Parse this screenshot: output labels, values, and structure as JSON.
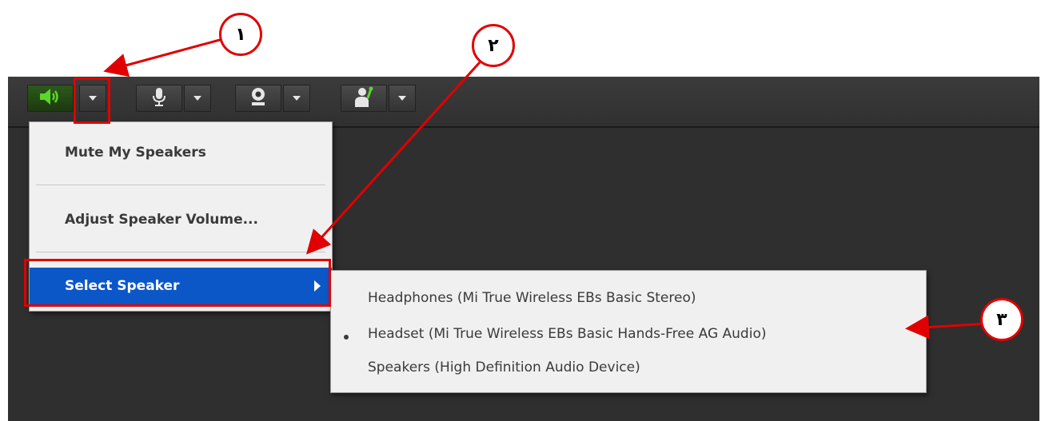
{
  "toolbar": {
    "speaker_icon": "speaker-volume-icon",
    "mic_icon": "microphone-icon",
    "camera_icon": "webcam-icon",
    "raise_hand_icon": "raise-hand-icon"
  },
  "menu": {
    "items": [
      {
        "label": "Mute My Speakers"
      },
      {
        "label": "Adjust Speaker Volume..."
      },
      {
        "label": "Select Speaker"
      }
    ]
  },
  "submenu": {
    "items": [
      {
        "label": "Headphones (Mi True Wireless EBs Basic Stereo)",
        "selected": false
      },
      {
        "label": "Headset (Mi True Wireless EBs Basic Hands-Free AG Audio)",
        "selected": true
      },
      {
        "label": "Speakers (High Definition Audio Device)",
        "selected": false
      }
    ]
  },
  "annotations": {
    "marker_1": "۱",
    "marker_2": "۲",
    "marker_3": "۳",
    "color": "#e00000"
  },
  "colors": {
    "selection": "#0c57c8",
    "active_speaker": "#5bd62a"
  }
}
